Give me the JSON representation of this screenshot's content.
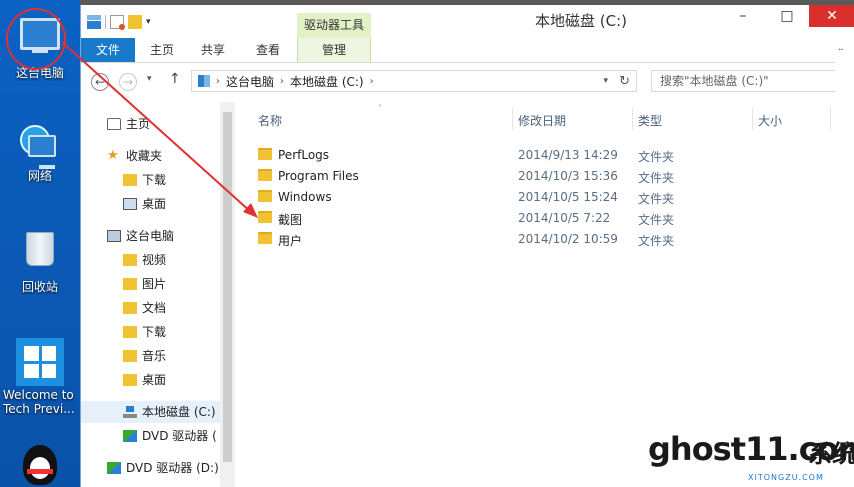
{
  "desktop": {
    "icons": [
      {
        "label": "这台电脑",
        "icon": "this-pc-icon"
      },
      {
        "label": "网络",
        "icon": "network-icon"
      },
      {
        "label": "回收站",
        "icon": "recycle-bin-icon"
      },
      {
        "label": "Welcome to Tech Previ...",
        "icon": "windows-logo-icon"
      },
      {
        "label": "",
        "icon": "qq-icon"
      }
    ]
  },
  "window": {
    "title": "本地磁盘 (C:)",
    "context_tab": "驱动器工具",
    "controls": {
      "minimize": "–",
      "maximize": "□",
      "close": "✕"
    }
  },
  "ribbon": {
    "tabs": [
      "文件",
      "主页",
      "共享",
      "查看",
      "管理"
    ]
  },
  "address": {
    "crumbs": [
      "这台电脑",
      "本地磁盘 (C:)"
    ],
    "search_placeholder": "搜索\"本地磁盘 (C:)\""
  },
  "nav": {
    "items": [
      {
        "label": "主页",
        "level": 0,
        "icon": "home-icon"
      },
      {
        "label": "收藏夹",
        "level": 0,
        "icon": "star-icon"
      },
      {
        "label": "下载",
        "level": 1,
        "icon": "download-folder-icon"
      },
      {
        "label": "桌面",
        "level": 1,
        "icon": "desktop-folder-icon"
      },
      {
        "label": "这台电脑",
        "level": 0,
        "icon": "this-pc-icon"
      },
      {
        "label": "视频",
        "level": 1,
        "icon": "video-folder-icon"
      },
      {
        "label": "图片",
        "level": 1,
        "icon": "pictures-folder-icon"
      },
      {
        "label": "文档",
        "level": 1,
        "icon": "documents-folder-icon"
      },
      {
        "label": "下载",
        "level": 1,
        "icon": "download-folder-icon"
      },
      {
        "label": "音乐",
        "level": 1,
        "icon": "music-folder-icon"
      },
      {
        "label": "桌面",
        "level": 1,
        "icon": "desktop-folder-icon"
      },
      {
        "label": "本地磁盘 (C:)",
        "level": 1,
        "icon": "drive-icon",
        "selected": true
      },
      {
        "label": "DVD 驱动器 (",
        "level": 1,
        "icon": "dvd-icon"
      },
      {
        "label": "DVD 驱动器 (D:)",
        "level": 0,
        "icon": "dvd-icon"
      }
    ]
  },
  "files": {
    "columns": {
      "name": "名称",
      "modified": "修改日期",
      "type": "类型",
      "size": "大小"
    },
    "rows": [
      {
        "name": "PerfLogs",
        "modified": "2014/9/13 14:29",
        "type": "文件夹"
      },
      {
        "name": "Program Files",
        "modified": "2014/10/3 15:36",
        "type": "文件夹"
      },
      {
        "name": "Windows",
        "modified": "2014/10/5 15:24",
        "type": "文件夹"
      },
      {
        "name": "截图",
        "modified": "2014/10/5 7:22",
        "type": "文件夹"
      },
      {
        "name": "用户",
        "modified": "2014/10/2 10:59",
        "type": "文件夹"
      }
    ]
  },
  "watermark": {
    "main": "ghost11.com",
    "sub": "XITONGZU.COM",
    "tail": "系统族"
  },
  "colors": {
    "accent": "#1979ca",
    "annotation": "#e03030",
    "context_tab": "#e3f1c8"
  }
}
